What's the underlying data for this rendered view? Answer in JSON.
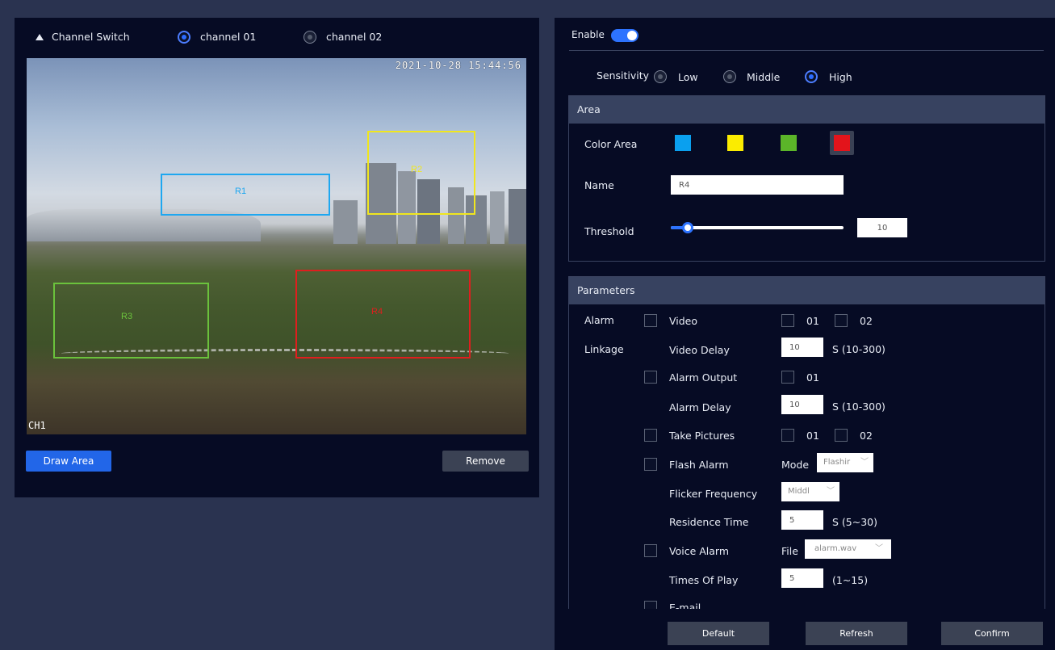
{
  "channel": {
    "label": "Channel Switch",
    "options": [
      {
        "label": "channel 01",
        "selected": true
      },
      {
        "label": "channel 02",
        "selected": false
      }
    ]
  },
  "video": {
    "timestamp": "2021-10-28 15:44:56",
    "osd": "CH1",
    "regions": [
      {
        "label": "R1",
        "color": "#1ea7f0"
      },
      {
        "label": "R2",
        "color": "#f0e61e"
      },
      {
        "label": "R3",
        "color": "#6bc23c"
      },
      {
        "label": "R4",
        "color": "#e01e1e"
      }
    ]
  },
  "actions": {
    "draw": "Draw Area",
    "remove": "Remove"
  },
  "enable": {
    "label": "Enable",
    "on": true
  },
  "sensitivity": {
    "label": "Sensitivity",
    "options": [
      {
        "label": "Low",
        "selected": false
      },
      {
        "label": "Middle",
        "selected": false
      },
      {
        "label": "High",
        "selected": true
      }
    ]
  },
  "area": {
    "title": "Area",
    "color_label": "Color Area",
    "colors": [
      "#0aa0ef",
      "#fbec00",
      "#5bb529",
      "#e3141b"
    ],
    "selected_color_index": 3,
    "name_label": "Name",
    "name_value": "R4",
    "threshold_label": "Threshold",
    "threshold_value": "10",
    "threshold_fraction": 0.1
  },
  "parameters": {
    "title": "Parameters",
    "alarm_label": "Alarm",
    "linkage_label": "Linkage",
    "video": "Video",
    "ch01": "01",
    "ch02": "02",
    "video_delay": "Video Delay",
    "video_delay_value": "10",
    "range_10_300": "S  (10-300)",
    "alarm_output": "Alarm Output",
    "alarm_delay": "Alarm Delay",
    "alarm_delay_value": "10",
    "take_pictures": "Take Pictures",
    "flash_alarm": "Flash Alarm",
    "mode": "Mode",
    "mode_value": "Flashir",
    "flicker_frequency": "Flicker Frequency",
    "flicker_value": "Middl",
    "residence_time": "Residence Time",
    "residence_value": "5",
    "range_5_30": "S (5~30)",
    "voice_alarm": "Voice Alarm",
    "file": "File",
    "file_value": "alarm.wav",
    "times_of_play": "Times Of Play",
    "times_value": "5",
    "range_1_15": "(1~15)",
    "email": "E-mail"
  },
  "footer": {
    "default": "Default",
    "refresh": "Refresh",
    "confirm": "Confirm"
  }
}
